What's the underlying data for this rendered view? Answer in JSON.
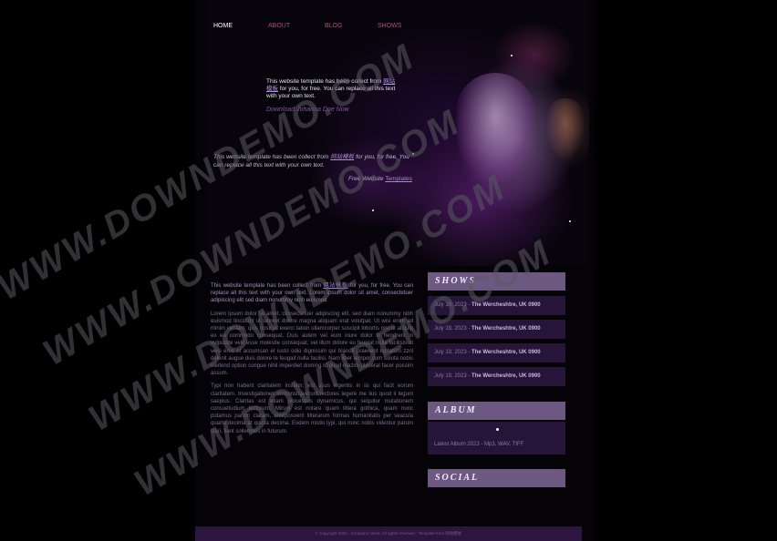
{
  "nav": {
    "home": "HOME",
    "about": "ABOUT",
    "blog": "BLOG",
    "shows": "SHOWS"
  },
  "intro": {
    "text_before": "This website template has been collect from",
    "link": "网站模板",
    "text_after": "for you, for free. You can replace all this text with your own text.",
    "download": "Download Johanna Doe Now"
  },
  "intro2": {
    "text_before": "This website template has been collect from",
    "link": "网站模板",
    "text_after": "for you, for free. You can replace all this text with your own text."
  },
  "free_templates": {
    "prefix": "Free Website",
    "link": "Templates"
  },
  "content": {
    "p1_before": "This website template has been collect from",
    "p1_link": "网站模板",
    "p1_after": "for you, for free. You can replace all this text with your own text. Lorem ipsum dolor sit amet, consectetuer adipiscing elit sed diam nonummy nibh euismod",
    "p2": "Lorem ipsum dolor sit amet, consectetuer adipiscing elit, sed diam nonummy nibh euismod tincidunt ut laoreet dolore magna aliquam erat volutpat. Ut wisi enim ad minim veniam, quis nostrud exerci tation ullamcorper suscipit lobortis nisl ut aliquip ex ea commodo consequat. Duis autem vel eum iriure dolor in hendrerit in vulputate velit esse molestie consequat, vel illum dolore eu feugiat nulla facilisis at vero eros et accumsan et iusto odio dignissim qui blandit praesent luptatum zzril delenit augue duis dolore te feugait nulla facilisi. Nam liber tempor cum soluta nobis eleifend option congue nihil imperdiet doming id quod mazim placerat facer possim assum.",
    "p3": "Typi non habent claritatem insitam; est usus legentis in iis qui facit eorum claritatem. Investigationes demonstraverunt lectores legere me lius quod ii legunt saepius. Claritas est etiam processus dynamicus, qui sequitur mutationem consuetudium lectorum. Mirum est notare quam littera gothica, quam nunc putamus parum claram, anteposuerit litterarum formas humanitatis per seacula quarta decima et quinta decima. Eodem modo typi, qui nunc nobis videntur parum clari, fiant sollemnes in futurum."
  },
  "sidebar": {
    "shows_title": "SHOWS",
    "shows": [
      {
        "date": "July 19, 2023",
        "sep": "-",
        "venue": "The Wercheshtre, UK 0900"
      },
      {
        "date": "July 19, 2023",
        "sep": "-",
        "venue": "The Wercheshtre, UK 0900"
      },
      {
        "date": "July 19, 2023",
        "sep": "-",
        "venue": "The Wercheshtre, UK 0900"
      },
      {
        "date": "July 19, 2023",
        "sep": "-",
        "venue": "The Wercheshtre, UK 0900"
      }
    ],
    "album_title": "ALBUM",
    "album_text": "Latest Album 2023 - Mp3, WAV, TIFF",
    "social_title": "SOCIAL"
  },
  "footer": {
    "text": "© Copyright 2023 - Company name, All rights reserved - Template from 网站模板"
  },
  "watermark": {
    "text": "WWW.DOWNDEMO.COM"
  },
  "colors": {
    "nav_link": "#c2437a",
    "panel_head": "#6d5882",
    "panel_row": "#261538",
    "footer_bg": "#2c163f"
  }
}
